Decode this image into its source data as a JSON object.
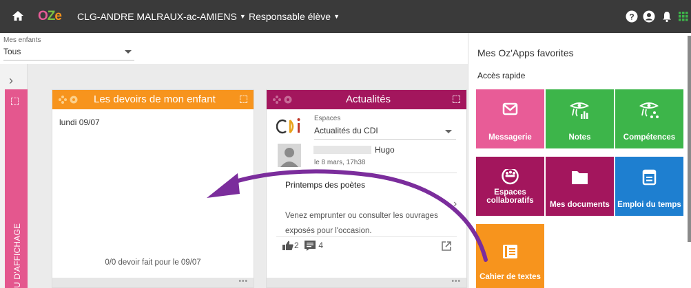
{
  "topbar": {
    "logo_o": "O",
    "logo_z": "Z",
    "logo_e": "e",
    "school": "CLG-ANDRE MALRAUX-ac-AMIENS",
    "role": "Responsable élève",
    "icons": [
      "home-icon",
      "help-icon",
      "user-icon",
      "bell-icon",
      "apps-grid-icon"
    ]
  },
  "children": {
    "label": "Mes enfants",
    "selected": "Tous"
  },
  "display_tab": "U D'AFFICHAGE",
  "homework_widget": {
    "title": "Les devoirs de mon enfant",
    "date": "lundi 09/07",
    "status": "0/0 devoir fait pour le 09/07"
  },
  "news_widget": {
    "title": "Actualités",
    "space_label": "Espaces",
    "space_value": "Actualités du CDI",
    "author": "Hugo",
    "post_date": "le 8 mars, 17h38",
    "post_title": "Printemps des poètes",
    "post_body": "Venez emprunter ou consulter les ouvrages exposés pour l'occasion.",
    "likes": "2",
    "comments": "4"
  },
  "apps_panel": {
    "title": "Mes Oz'Apps favorites",
    "subtitle": "Accès rapide",
    "tiles": [
      {
        "label": "Messagerie",
        "color": "#e85c97",
        "icon": "envelope-icon"
      },
      {
        "label": "Notes",
        "color": "#3db54a",
        "icon": "eye-chart-icon"
      },
      {
        "label": "Compétences",
        "color": "#3db54a",
        "icon": "eye-skills-icon"
      },
      {
        "label": "Espaces collaboratifs",
        "color": "#a3165d",
        "icon": "group-icon"
      },
      {
        "label": "Mes documents",
        "color": "#a3165d",
        "icon": "folder-icon"
      },
      {
        "label": "Emploi du temps",
        "color": "#1e7fd0",
        "icon": "calendar-icon"
      },
      {
        "label": "Cahier de textes",
        "color": "#f7941d",
        "icon": "notebook-icon"
      }
    ]
  },
  "colors": {
    "topbar": "#3a3a3a",
    "homework": "#f7941d",
    "news": "#a3165d",
    "arrow": "#7b2d9c"
  }
}
